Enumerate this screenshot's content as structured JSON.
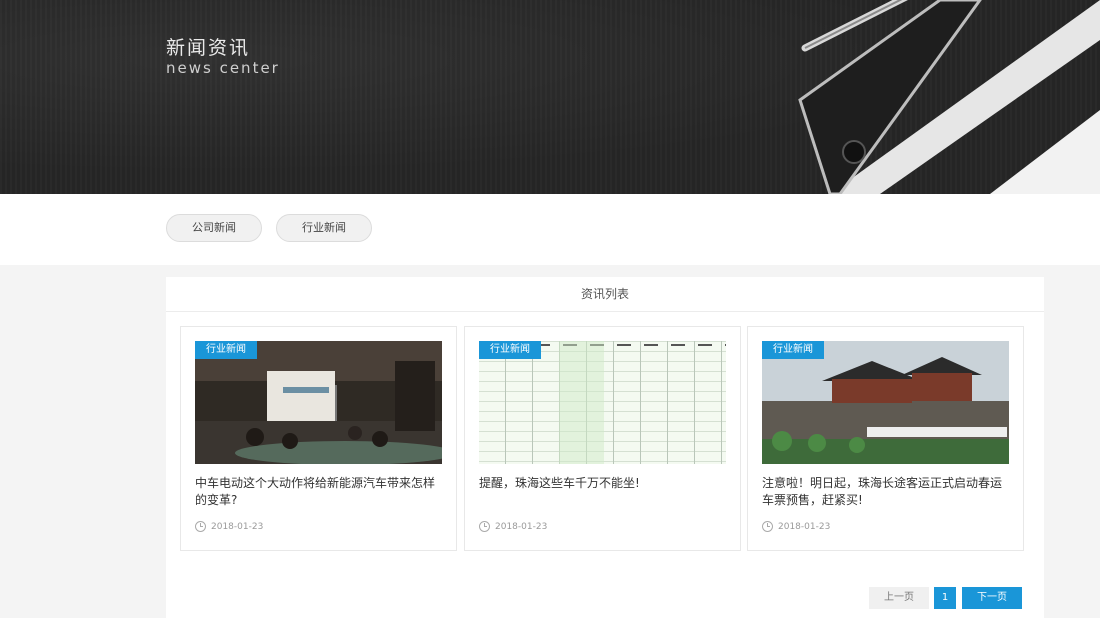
{
  "banner": {
    "title": "新闻资讯",
    "subtitle": "news center"
  },
  "tabs": [
    {
      "label": "公司新闻"
    },
    {
      "label": "行业新闻"
    }
  ],
  "panel": {
    "heading": "资讯列表"
  },
  "cards": [
    {
      "badge": "行业新闻",
      "title": "中车电动这个大动作将给新能源汽车带来怎样的变革?",
      "date": "2018-01-23",
      "image": "meeting-room-photo"
    },
    {
      "badge": "行业新闻",
      "title": "提醒，珠海这些车千万不能坐!",
      "date": "2018-01-23",
      "image": "vehicle-list-spreadsheet"
    },
    {
      "badge": "行业新闻",
      "title": "注意啦！明日起，珠海长途客运正式启动春运车票预售，赶紧买!",
      "date": "2018-01-23",
      "image": "city-gate-with-buses-photo"
    }
  ],
  "pagination": {
    "prev": "上一页",
    "current": "1",
    "next": "下一页"
  },
  "colors": {
    "accent": "#1a96d8",
    "banner_bg": "#262626"
  }
}
